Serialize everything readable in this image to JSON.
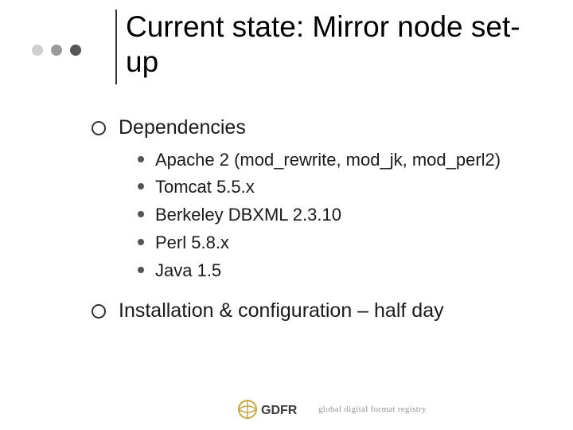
{
  "deco_colors": [
    "#cfcfcf",
    "#9a9a9a",
    "#575757"
  ],
  "title": "Current state: Mirror node set-up",
  "sections": [
    {
      "label": "Dependencies",
      "items": [
        "Apache 2 (mod_rewrite, mod_jk, mod_perl2)",
        "Tomcat 5.5.x",
        "Berkeley DBXML 2.3.10",
        "Perl 5.8.x",
        "Java 1.5"
      ]
    },
    {
      "label": "Installation & configuration – half day",
      "items": []
    }
  ],
  "footer": {
    "acronym": "GDFR",
    "text": "global digital format registry"
  }
}
